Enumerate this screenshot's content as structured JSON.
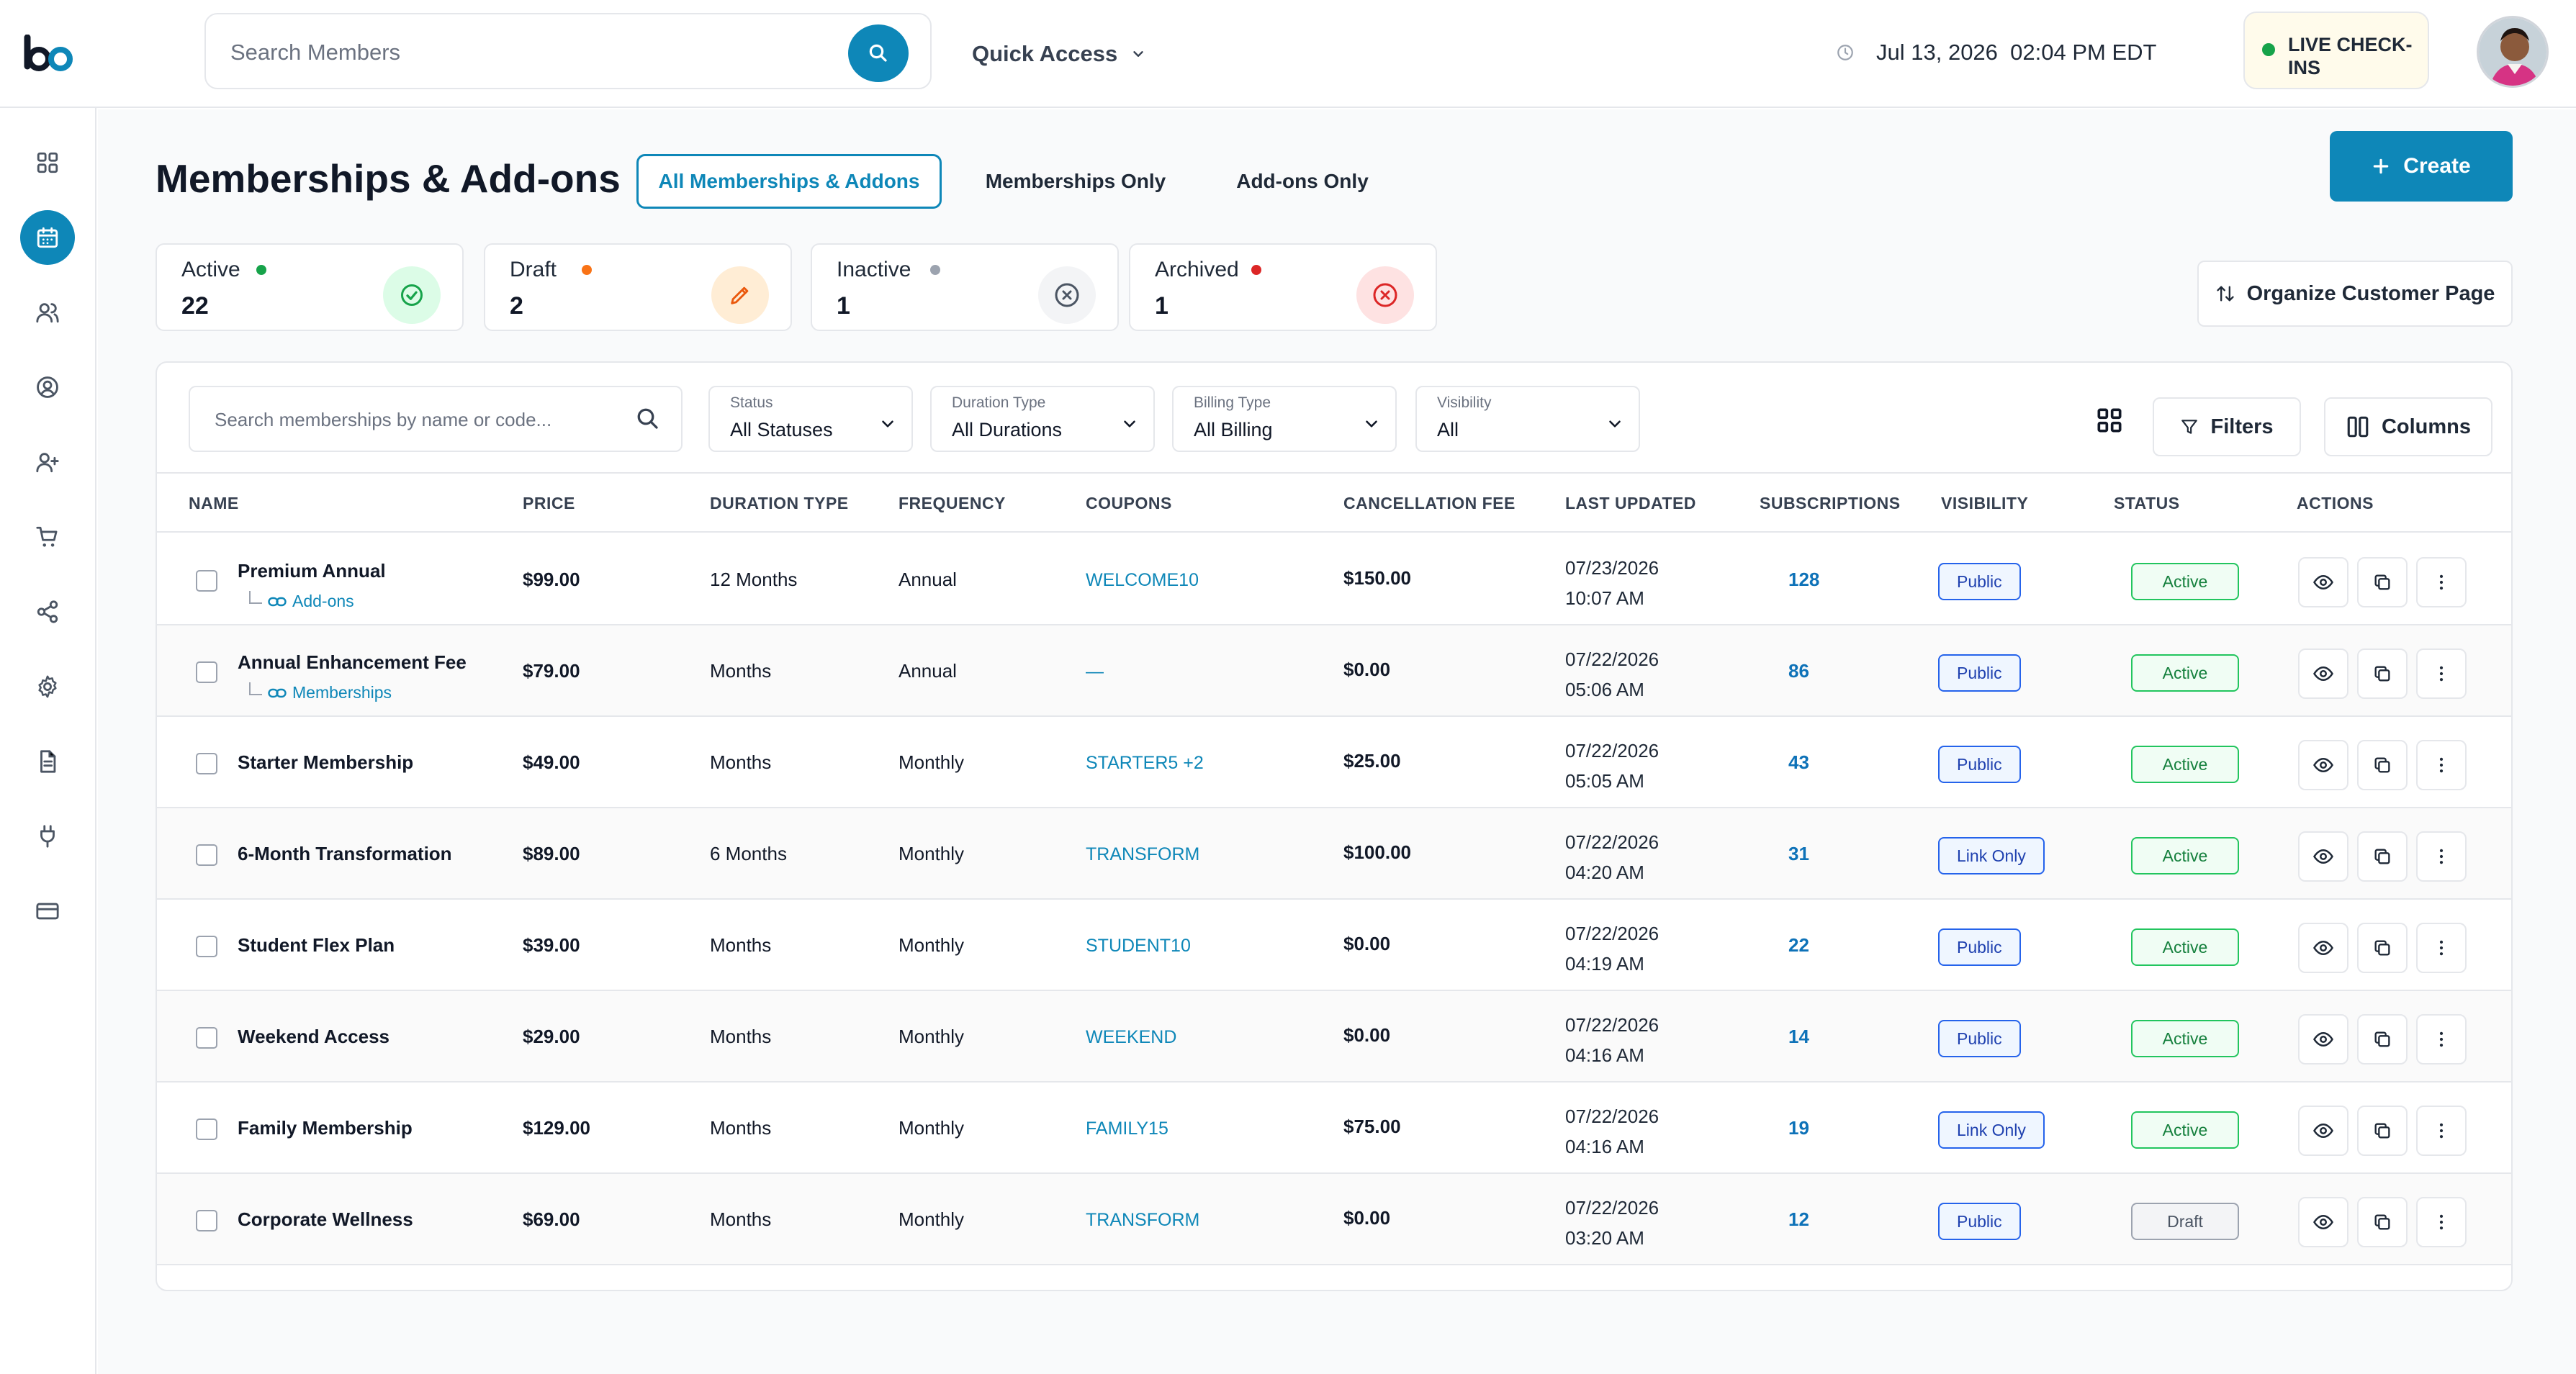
{
  "header": {
    "search_placeholder": "Search Members",
    "quick_access": "Quick Access",
    "datetime": "Jul 13, 2026  02:04 PM EDT",
    "live_checkins": "LIVE CHECK-INS"
  },
  "page": {
    "title": "Memberships & Add-ons",
    "tabs": [
      {
        "label": "All Memberships & Addons",
        "active": true
      },
      {
        "label": "Memberships Only",
        "active": false
      },
      {
        "label": "Add-ons Only",
        "active": false
      }
    ],
    "create_label": "Create",
    "organize_label": "Organize Customer Page"
  },
  "stats": [
    {
      "label": "Active",
      "value": "22",
      "color": "#16a34a"
    },
    {
      "label": "Draft",
      "value": "2",
      "color": "#f97316"
    },
    {
      "label": "Inactive",
      "value": "1",
      "color": "#9ca3af"
    },
    {
      "label": "Archived",
      "value": "1",
      "color": "#dc2626"
    }
  ],
  "toolbar": {
    "search_placeholder": "Search memberships by name or code...",
    "filters": [
      {
        "label": "Status",
        "value": "All Statuses"
      },
      {
        "label": "Duration Type",
        "value": "All Durations"
      },
      {
        "label": "Billing Type",
        "value": "All Billing"
      },
      {
        "label": "Visibility",
        "value": "All"
      }
    ],
    "filters_label": "Filters",
    "columns_label": "Columns"
  },
  "table": {
    "headers": [
      "NAME",
      "PRICE",
      "DURATION TYPE",
      "FREQUENCY",
      "COUPONS",
      "CANCELLATION FEE",
      "LAST UPDATED",
      "SUBSCRIPTIONS",
      "VISIBILITY",
      "STATUS",
      "ACTIONS"
    ],
    "rows": [
      {
        "name": "Premium Annual",
        "sub": "Add-ons",
        "price": "$99.00",
        "duration": "12 Months",
        "frequency": "Annual",
        "coupon": "WELCOME10",
        "fee": "$150.00",
        "date": "07/23/2026",
        "time": "10:07 AM",
        "subs": "128",
        "visibility": "Public",
        "status": "Active"
      },
      {
        "name": "Annual Enhancement Fee",
        "sub": "Memberships",
        "price": "$79.00",
        "duration": "Months",
        "frequency": "Annual",
        "coupon": "—",
        "fee": "$0.00",
        "date": "07/22/2026",
        "time": "05:06 AM",
        "subs": "86",
        "visibility": "Public",
        "status": "Active"
      },
      {
        "name": "Starter Membership",
        "sub": "",
        "price": "$49.00",
        "duration": "Months",
        "frequency": "Monthly",
        "coupon": "STARTER5 +2",
        "fee": "$25.00",
        "date": "07/22/2026",
        "time": "05:05 AM",
        "subs": "43",
        "visibility": "Public",
        "status": "Active"
      },
      {
        "name": "6-Month Transformation",
        "sub": "",
        "price": "$89.00",
        "duration": "6 Months",
        "frequency": "Monthly",
        "coupon": "TRANSFORM",
        "fee": "$100.00",
        "date": "07/22/2026",
        "time": "04:20 AM",
        "subs": "31",
        "visibility": "Link Only",
        "status": "Active"
      },
      {
        "name": "Student Flex Plan",
        "sub": "",
        "price": "$39.00",
        "duration": "Months",
        "frequency": "Monthly",
        "coupon": "STUDENT10",
        "fee": "$0.00",
        "date": "07/22/2026",
        "time": "04:19 AM",
        "subs": "22",
        "visibility": "Public",
        "status": "Active"
      },
      {
        "name": "Weekend Access",
        "sub": "",
        "price": "$29.00",
        "duration": "Months",
        "frequency": "Monthly",
        "coupon": "WEEKEND",
        "fee": "$0.00",
        "date": "07/22/2026",
        "time": "04:16 AM",
        "subs": "14",
        "visibility": "Public",
        "status": "Active"
      },
      {
        "name": "Family Membership",
        "sub": "",
        "price": "$129.00",
        "duration": "Months",
        "frequency": "Monthly",
        "coupon": "FAMILY15",
        "fee": "$75.00",
        "date": "07/22/2026",
        "time": "04:16 AM",
        "subs": "19",
        "visibility": "Link Only",
        "status": "Active"
      },
      {
        "name": "Corporate Wellness",
        "sub": "",
        "price": "$69.00",
        "duration": "Months",
        "frequency": "Monthly",
        "coupon": "TRANSFORM",
        "fee": "$0.00",
        "date": "07/22/2026",
        "time": "03:20 AM",
        "subs": "12",
        "visibility": "Public",
        "status": "Draft"
      }
    ]
  },
  "colors": {
    "accent": "#0e87b8",
    "active": "#22c55e",
    "link": "#0e72b8"
  }
}
